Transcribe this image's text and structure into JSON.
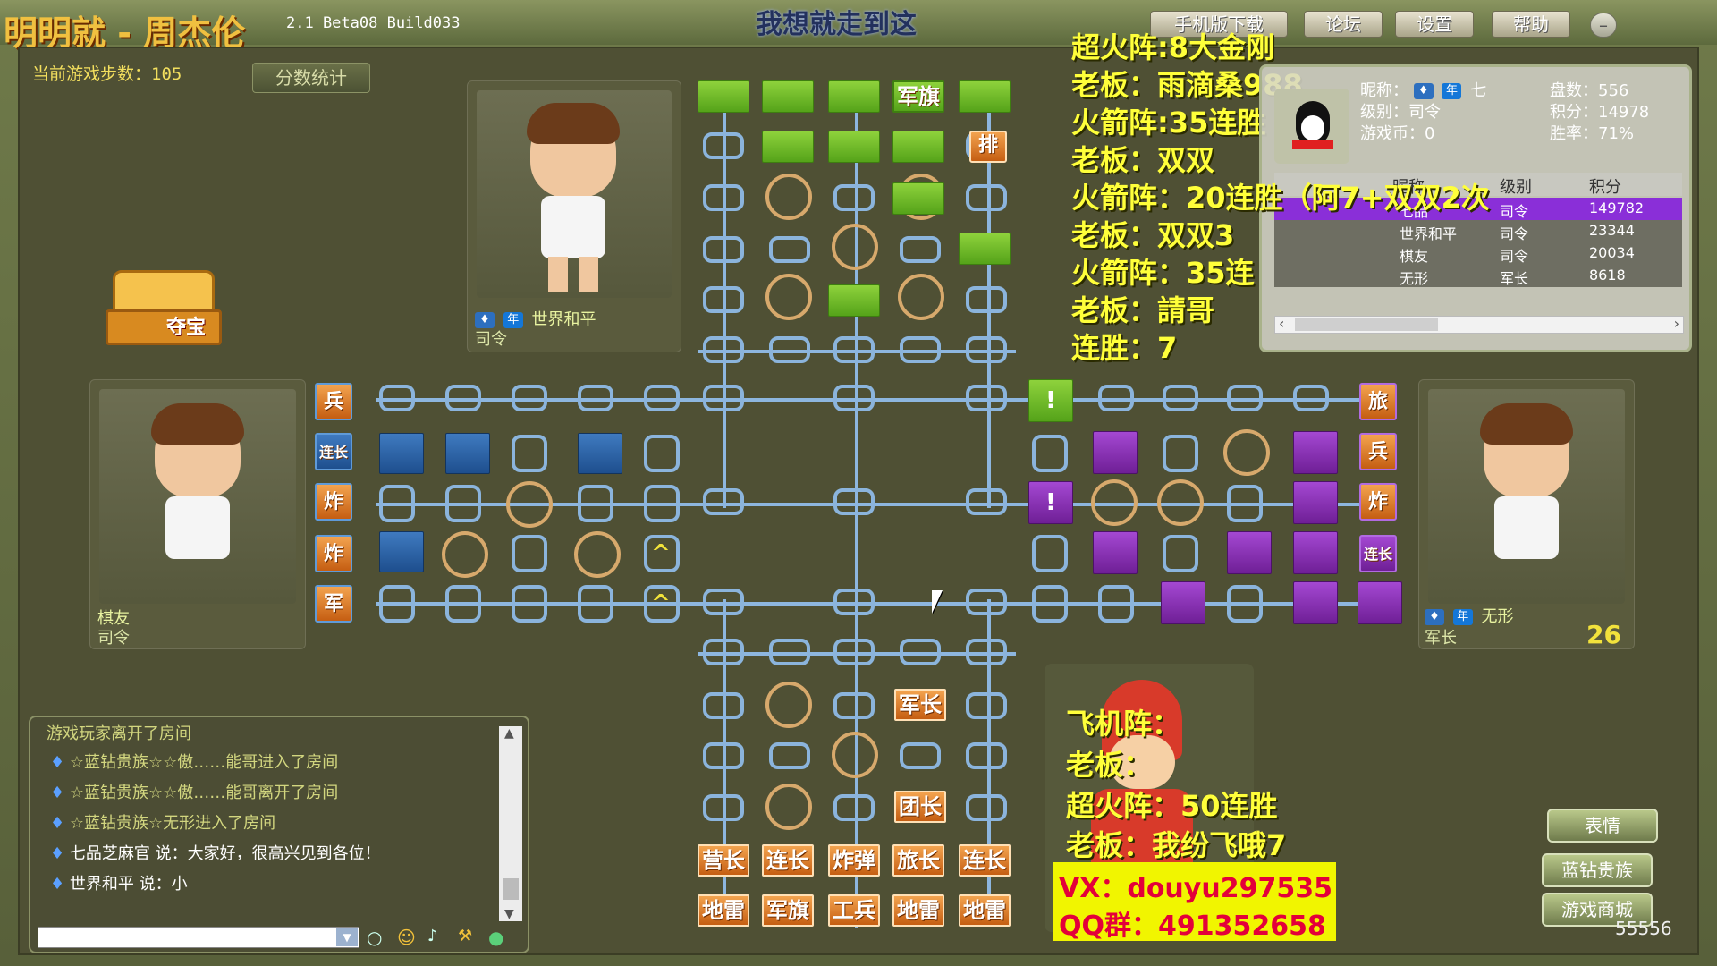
{
  "window": {
    "title_overlay": "明明就 - 周杰伦",
    "version_text": "2.1 Beta08 Build033",
    "center_title": "我想就走到这",
    "buttons": [
      "手机版下载",
      "论坛",
      "设置",
      "帮助"
    ]
  },
  "game": {
    "steps_label": "当前游戏步数：105",
    "score_stats_label": "分数统计",
    "treasure_label": "夺宝"
  },
  "players": {
    "top": {
      "name": "世界和平",
      "rank": "司令",
      "badge": "年"
    },
    "left": {
      "name": "棋友",
      "rank": "司令"
    },
    "right": {
      "name": "无形",
      "rank": "军长",
      "badge": "年",
      "timer": "26"
    }
  },
  "board": {
    "top_pieces": [
      "军旗",
      "排"
    ],
    "left_side_pieces": [
      "兵",
      "连长",
      "炸",
      "炸",
      "军"
    ],
    "right_side_pieces": [
      "旅",
      "兵",
      "炸",
      "连长"
    ],
    "bottom_pieces_row1": [
      "军长",
      "团长"
    ],
    "bottom_pieces_row2": [
      "营长",
      "连长",
      "炸弹",
      "旅长",
      "连长"
    ],
    "bottom_pieces_row3": [
      "地雷",
      "军旗",
      "工兵",
      "地雷",
      "地雷"
    ],
    "alert_mark": "!",
    "arrow_mark": "^"
  },
  "stream_overlay": {
    "lines": [
      "超火阵:8大金刚",
      "老板：雨滴桑988",
      "火箭阵:35连胜",
      "老板：双双",
      "火箭阵：20连胜（阿7+双双2次",
      "老板：双双3",
      "火箭阵：35连",
      "老板：請哥",
      "连胜：7"
    ],
    "bottom_lines": [
      "飞机阵：",
      "老板：",
      "超火阵：50连胜",
      "老板：我纷飞哦7"
    ],
    "ad_vx": "VX：douyu297535",
    "ad_qq": "QQ群：491352658"
  },
  "info_panel": {
    "nickname_label": "昵称：",
    "nickname_value": "七",
    "level_label": "级别：司令",
    "coins_label": "游戏币：0",
    "games_label": "盘数：556",
    "score_label": "积分：14978",
    "winrate_label": "胜率：71%",
    "table_headers": [
      "昵称",
      "级别",
      "积分"
    ],
    "rows": [
      {
        "name": "七品",
        "rank": "司令",
        "score": "149782"
      },
      {
        "name": "世界和平",
        "rank": "司令",
        "score": "23344"
      },
      {
        "name": "棋友",
        "rank": "司令",
        "score": "20034"
      },
      {
        "name": "无形",
        "rank": "军长",
        "score": "8618"
      }
    ]
  },
  "chat": {
    "header": "游戏玩家离开了房间",
    "lines": [
      "☆蓝钻贵族☆☆傲……能哥进入了房间",
      "☆蓝钻贵族☆☆傲……能哥离开了房间",
      "☆蓝钻贵族☆无形进入了房间",
      "七品芝麻官 说：大家好，很高兴见到各位！",
      "世界和平 说：小"
    ]
  },
  "right_buttons": [
    "表情",
    "蓝钻贵族",
    "游戏商城"
  ],
  "watermark_number": "55556",
  "colors": {
    "board_line": "#8db6df",
    "green": "#6cba2a",
    "blue": "#2f66a8",
    "purple": "#8a2fb8",
    "orange": "#e3842f"
  }
}
